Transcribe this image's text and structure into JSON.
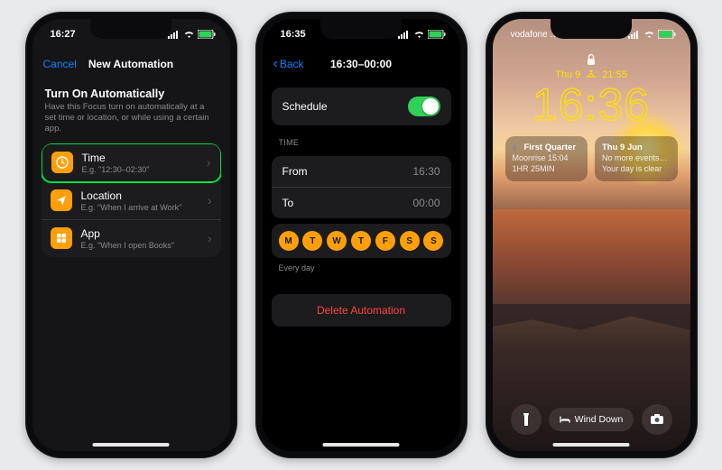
{
  "screen1": {
    "status_time": "16:27",
    "nav_cancel": "Cancel",
    "nav_title": "New Automation",
    "section_title": "Turn On Automatically",
    "section_sub": "Have this Focus turn on automatically at a set time or location, or while using a certain app.",
    "rows": [
      {
        "title": "Time",
        "sub": "E.g. \"12:30–02:30\""
      },
      {
        "title": "Location",
        "sub": "E.g. \"When I arrive at Work\""
      },
      {
        "title": "App",
        "sub": "E.g. \"When I open Books\""
      }
    ]
  },
  "screen2": {
    "status_time": "16:35",
    "nav_back": "Back",
    "nav_title": "16:30–00:00",
    "schedule_label": "Schedule",
    "time_header": "TIME",
    "from_label": "From",
    "from_value": "16:30",
    "to_label": "To",
    "to_value": "00:00",
    "days": [
      "M",
      "T",
      "W",
      "T",
      "F",
      "S",
      "S"
    ],
    "days_footnote": "Every day",
    "delete_label": "Delete Automation"
  },
  "screen3": {
    "carrier": "vodafone …",
    "date_line": "Thu 9",
    "temp": "21:55",
    "time": "16:36",
    "widget_left_title": "First Quarter",
    "widget_left_l1": "Moonrise 15:04",
    "widget_left_l2": "1HR 25MIN",
    "widget_right_title": "Thu 9 Jun",
    "widget_right_l1": "No more events…",
    "widget_right_l2": "Your day is clear",
    "focus_pill": "Wind Down"
  }
}
